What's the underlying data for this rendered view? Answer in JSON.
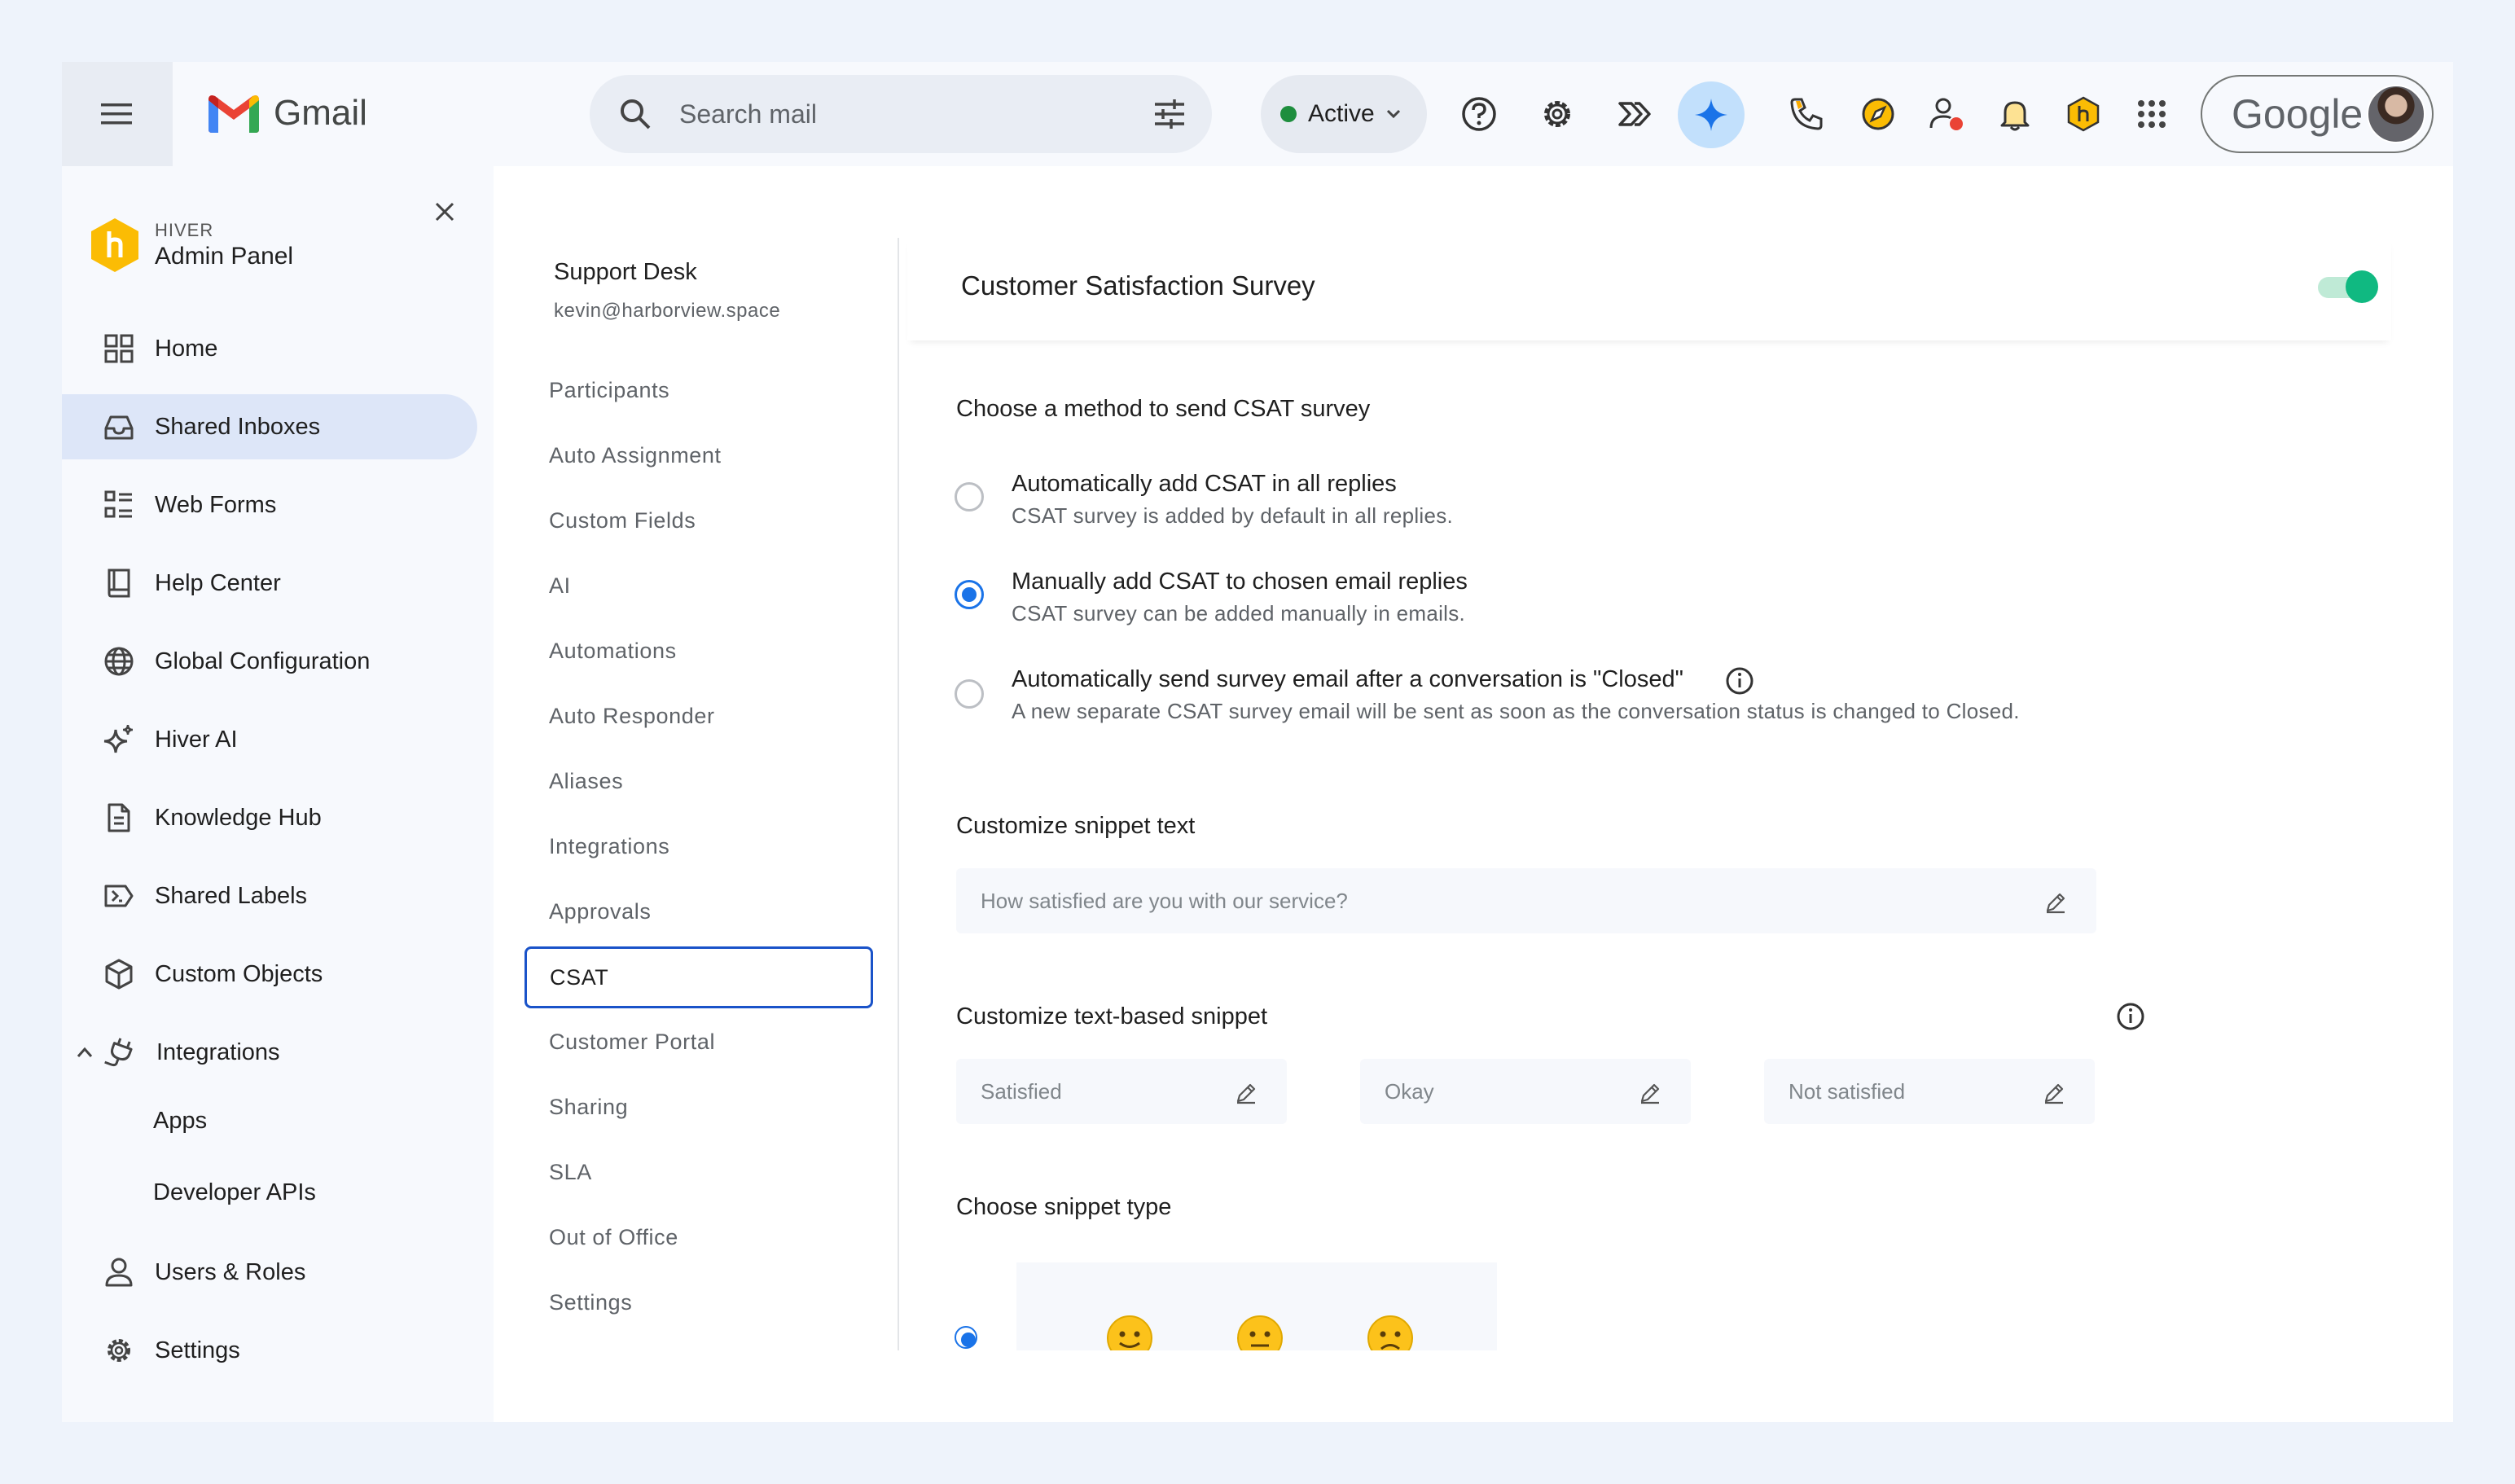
{
  "topbar": {
    "app_name": "Gmail",
    "search_placeholder": "Search mail",
    "status_label": "Active",
    "status_color": "#1e8e3e",
    "account_brand": "Google",
    "icons": [
      "menu-icon",
      "search-icon",
      "filter-options-icon",
      "help-icon",
      "settings-gear-icon",
      "workflow-icon",
      "gemini-sparkle-icon",
      "phone-icon",
      "compass-icon",
      "user-status-icon",
      "bell-icon",
      "hiver-icon",
      "apps-grid-icon"
    ]
  },
  "admin_panel": {
    "brand_small": "HIVER",
    "brand_title": "Admin Panel",
    "nav": [
      {
        "label": "Home",
        "icon": "grid-icon"
      },
      {
        "label": "Shared Inboxes",
        "icon": "inbox-icon",
        "active": true
      },
      {
        "label": "Web Forms",
        "icon": "form-list-icon"
      },
      {
        "label": "Help Center",
        "icon": "book-icon"
      },
      {
        "label": "Global Configuration",
        "icon": "globe-icon"
      },
      {
        "label": "Hiver AI",
        "icon": "sparkle-icon"
      },
      {
        "label": "Knowledge Hub",
        "icon": "document-icon"
      },
      {
        "label": "Shared Labels",
        "icon": "label-icon"
      },
      {
        "label": "Custom Objects",
        "icon": "cube-icon"
      },
      {
        "label": "Integrations",
        "icon": "plug-icon",
        "expanded": true
      }
    ],
    "integrations_children": [
      "Apps",
      "Developer APIs"
    ],
    "nav_bottom": [
      {
        "label": "Users & Roles",
        "icon": "user-icon"
      },
      {
        "label": "Settings",
        "icon": "gear-icon"
      }
    ]
  },
  "inbox": {
    "name": "Support Desk",
    "email": "kevin@harborview.space",
    "menu": [
      "Participants",
      "Auto Assignment",
      "Custom Fields",
      "AI",
      "Automations",
      "Auto Responder",
      "Aliases",
      "Integrations",
      "Approvals",
      "CSAT",
      "Customer Portal",
      "Sharing",
      "SLA",
      "Out of Office",
      "Settings"
    ],
    "selected": "CSAT"
  },
  "csat": {
    "title": "Customer Satisfaction Survey",
    "enabled": true,
    "toggle_color": "#10b981",
    "method_title": "Choose a method to send CSAT survey",
    "options": [
      {
        "title": "Automatically add CSAT in all replies",
        "desc": "CSAT survey is added by default in all replies.",
        "selected": false
      },
      {
        "title": "Manually add CSAT to chosen email replies",
        "desc": "CSAT survey can be added manually in emails.",
        "selected": true
      },
      {
        "title": "Automatically send survey email after a conversation is \"Closed\"",
        "desc": "A new separate CSAT survey email will be sent as soon as the conversation status is changed to Closed.",
        "selected": false
      }
    ],
    "snippet_text_title": "Customize snippet text",
    "snippet_text_value": "How satisfied are you with our service?",
    "text_snippet_title": "Customize text-based snippet",
    "text_snippets": [
      "Satisfied",
      "Okay",
      "Not satisfied"
    ],
    "snippet_type_title": "Choose snippet type",
    "accent_color": "#1a73e8"
  }
}
